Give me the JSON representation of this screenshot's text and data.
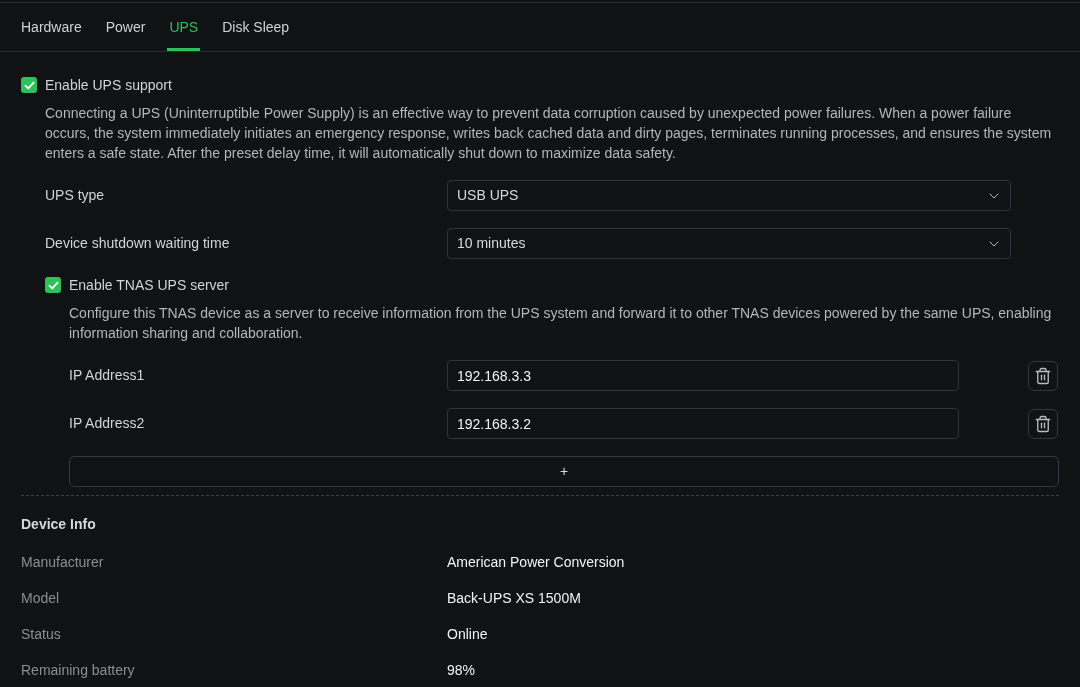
{
  "tabs": [
    {
      "label": "Hardware",
      "selected": false
    },
    {
      "label": "Power",
      "selected": false
    },
    {
      "label": "UPS",
      "selected": true
    },
    {
      "label": "Disk Sleep",
      "selected": false
    }
  ],
  "ups_support": {
    "label": "Enable UPS support",
    "checked": true,
    "description": "Connecting a UPS (Uninterruptible Power Supply) is an effective way to prevent data corruption caused by unexpected power failures. When a power failure occurs, the system immediately initiates an emergency response, writes back cached data and dirty pages, terminates running processes, and ensures the system enters a safe state. After the preset delay time, it will automatically shut down to maximize data safety."
  },
  "settings": [
    {
      "label": "UPS type",
      "value": "USB UPS"
    },
    {
      "label": "Device shutdown waiting time",
      "value": "10 minutes"
    }
  ],
  "ups_server": {
    "label": "Enable TNAS UPS server",
    "checked": true,
    "description": "Configure this TNAS device as a server to receive information from the UPS system and forward it to other TNAS devices powered by the same UPS, enabling information sharing and collaboration.",
    "ip_addresses": [
      {
        "label": "IP Address1",
        "value": "192.168.3.3"
      },
      {
        "label": "IP Address2",
        "value": "192.168.3.2"
      }
    ],
    "add_button": "+"
  },
  "device_info": {
    "title": "Device Info",
    "rows": [
      {
        "label": "Manufacturer",
        "value": "American Power Conversion"
      },
      {
        "label": "Model",
        "value": "Back-UPS XS 1500M"
      },
      {
        "label": "Status",
        "value": "Online"
      },
      {
        "label": "Remaining battery",
        "value": "98%"
      }
    ]
  }
}
